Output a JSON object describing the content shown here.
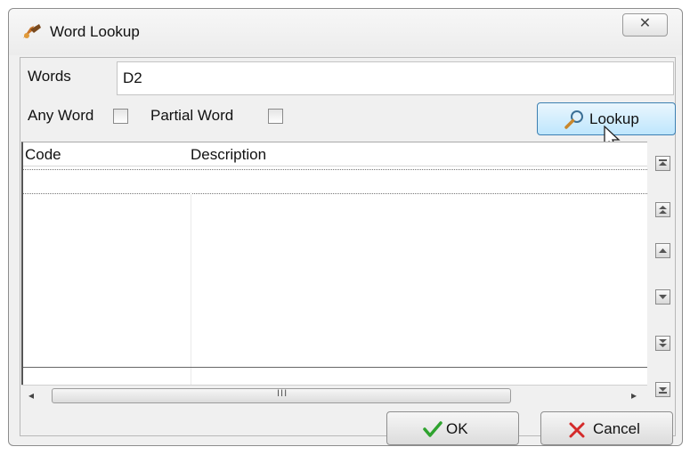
{
  "window": {
    "title": "Word Lookup",
    "close_glyph": "✕"
  },
  "words": {
    "label": "Words",
    "value": "D2"
  },
  "options": {
    "any_word_label": "Any Word",
    "partial_word_label": "Partial Word"
  },
  "lookup_button": {
    "label": "Lookup",
    "icon": "magnifier-icon"
  },
  "grid": {
    "columns": [
      "Code",
      "Description"
    ]
  },
  "scrollbar": {
    "left_arrow": "◂",
    "right_arrow": "▸",
    "grip": "III"
  },
  "buttons": {
    "ok_label": "OK",
    "cancel_label": "Cancel"
  },
  "colors": {
    "lookup_border": "#3c7fb1",
    "ok_check": "#2fa32f",
    "cancel_x": "#d42a2a"
  }
}
